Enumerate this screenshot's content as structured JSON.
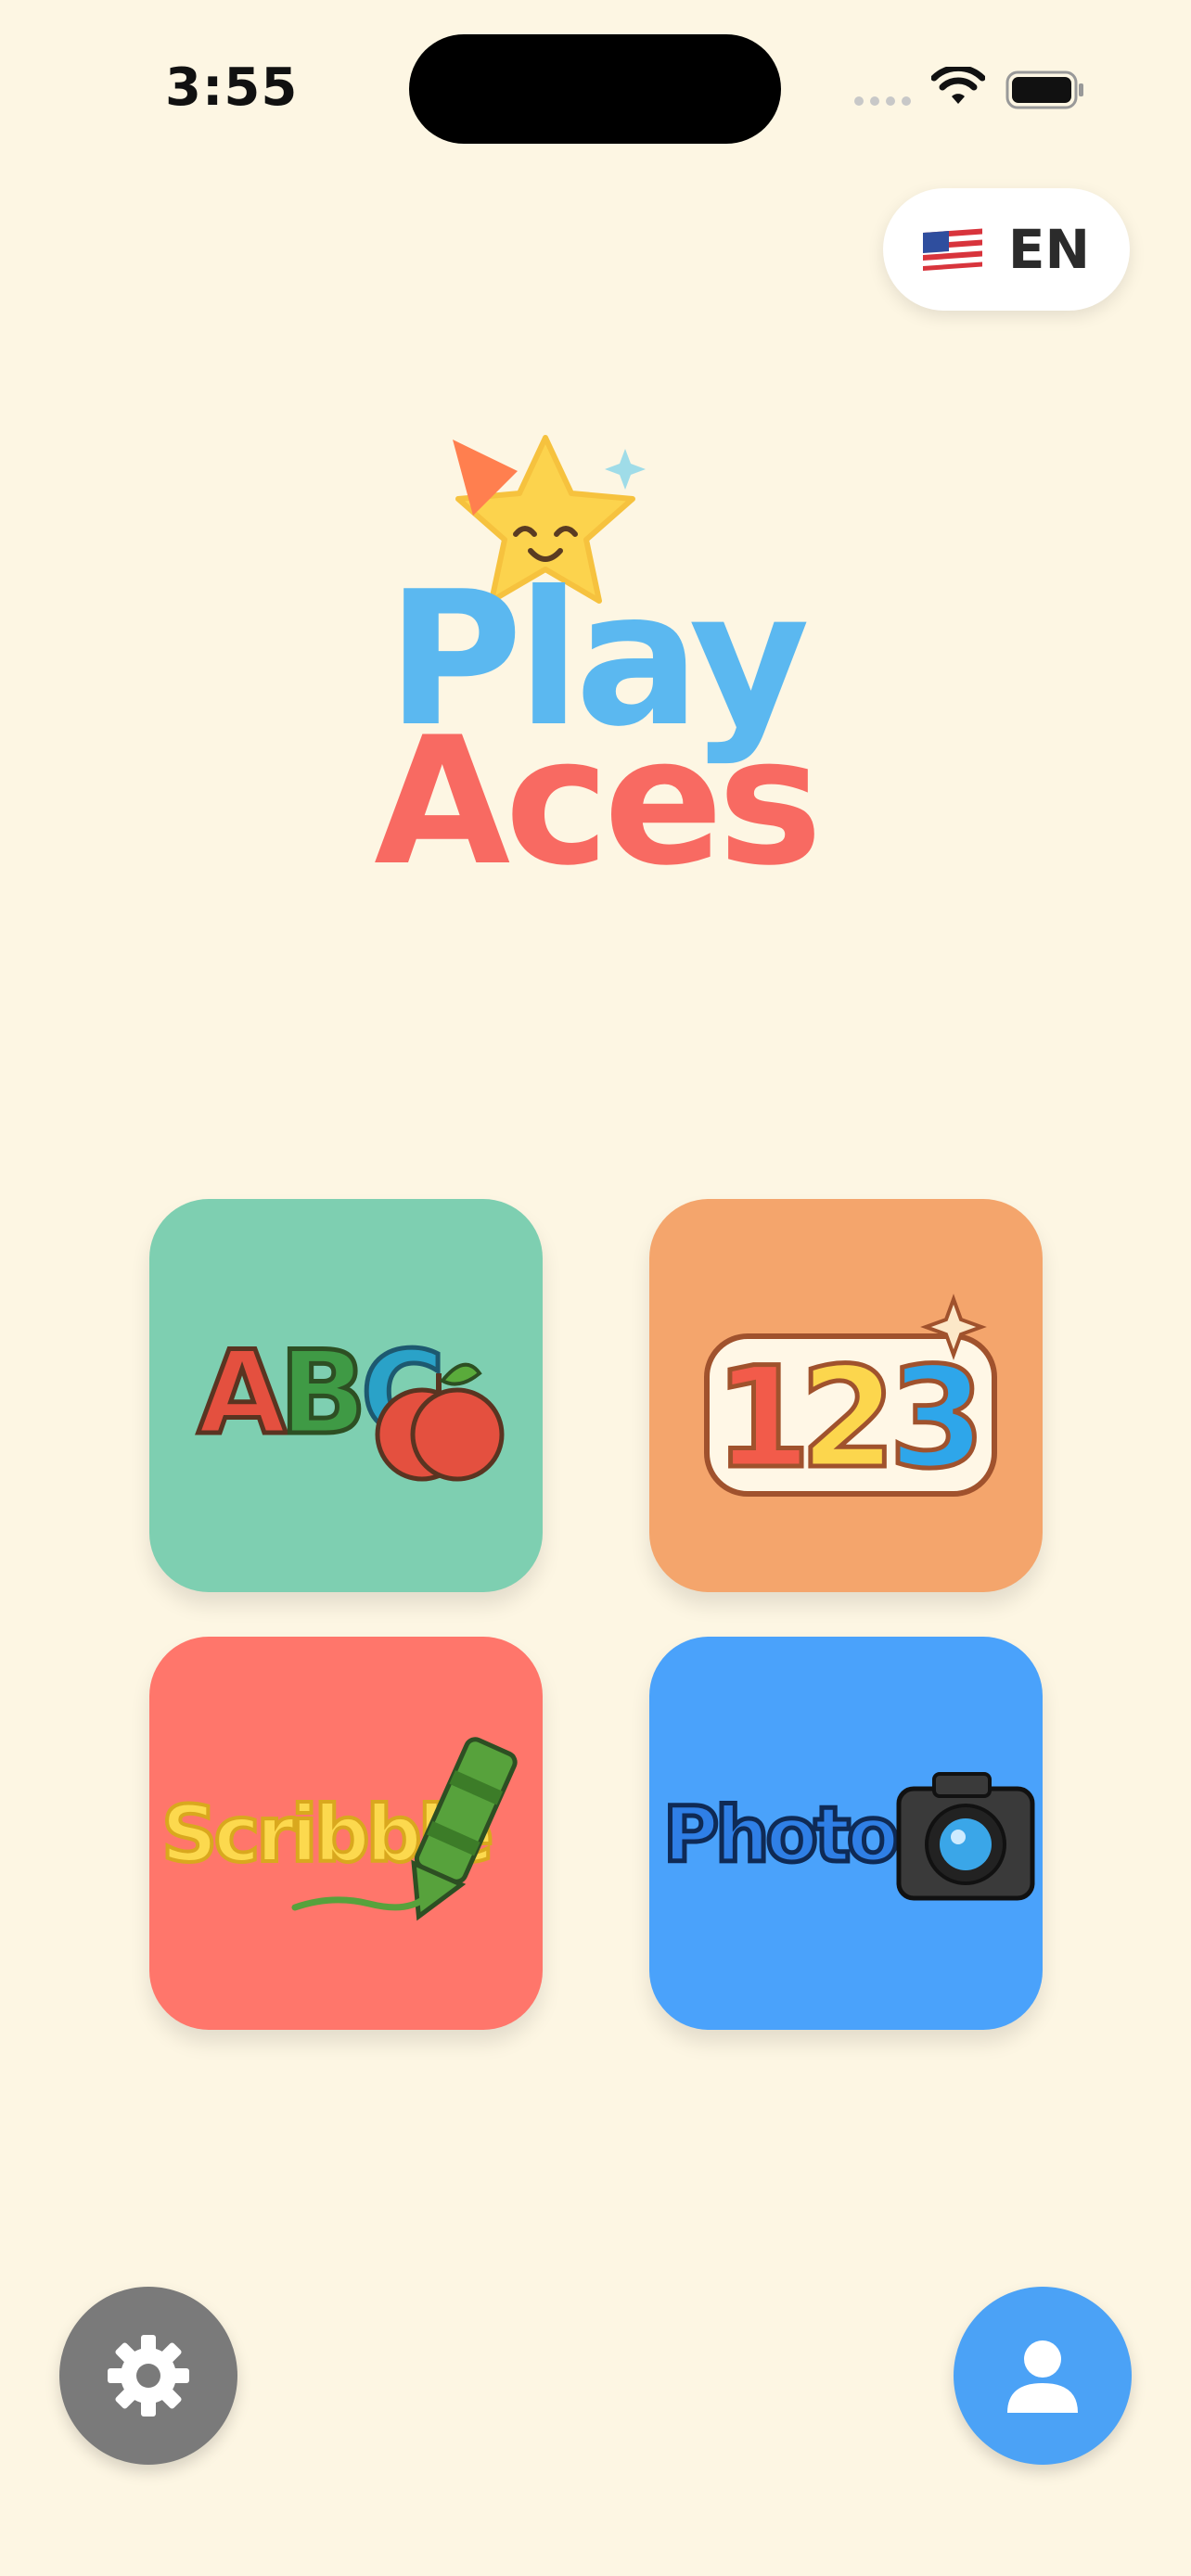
{
  "status_bar": {
    "time": "3:55"
  },
  "language": {
    "flag_icon": "us-flag-icon",
    "label": "EN"
  },
  "logo": {
    "line1": "Play",
    "line2": "Aces",
    "line1_color": "#5bb8f0",
    "line2_color": "#f86a62"
  },
  "tiles": [
    {
      "id": "abc",
      "text": "ABC",
      "color": "#7ecfb1",
      "icon": "apple-icon"
    },
    {
      "id": "123",
      "text": "123",
      "color": "#f4a56c",
      "icon": "sparkle-icon"
    },
    {
      "id": "scribble",
      "text": "Scribble",
      "color": "#ff766b",
      "icon": "crayon-icon"
    },
    {
      "id": "photos",
      "text": "Photos",
      "color": "#4aa2fb",
      "icon": "camera-icon"
    }
  ],
  "bottom": {
    "settings_icon": "gear-icon",
    "profile_icon": "person-icon"
  }
}
